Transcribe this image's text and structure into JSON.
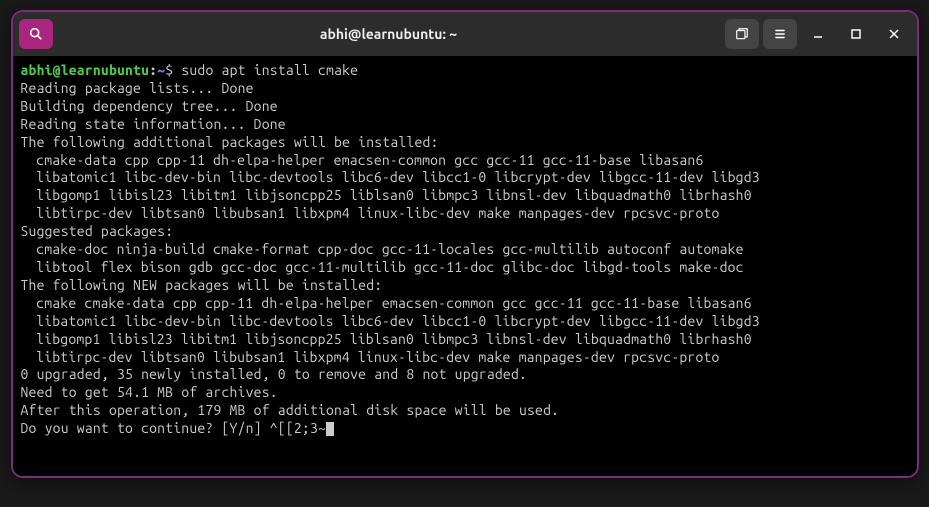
{
  "titlebar": {
    "title": "abhi@learnubuntu: ~"
  },
  "prompt": {
    "user_host": "abhi@learnubuntu",
    "path": "~",
    "symbol": "$",
    "command": "sudo apt install cmake"
  },
  "output": {
    "l1": "Reading package lists... Done",
    "l2": "Building dependency tree... Done",
    "l3": "Reading state information... Done",
    "l4": "The following additional packages will be installed:",
    "l5": "cmake-data cpp cpp-11 dh-elpa-helper emacsen-common gcc gcc-11 gcc-11-base libasan6",
    "l6": "libatomic1 libc-dev-bin libc-devtools libc6-dev libcc1-0 libcrypt-dev libgcc-11-dev libgd3",
    "l7": "libgomp1 libisl23 libitm1 libjsoncpp25 liblsan0 libmpc3 libnsl-dev libquadmath0 librhash0",
    "l8": "libtirpc-dev libtsan0 libubsan1 libxpm4 linux-libc-dev make manpages-dev rpcsvc-proto",
    "l9": "Suggested packages:",
    "l10": "cmake-doc ninja-build cmake-format cpp-doc gcc-11-locales gcc-multilib autoconf automake",
    "l11": "libtool flex bison gdb gcc-doc gcc-11-multilib gcc-11-doc glibc-doc libgd-tools make-doc",
    "l12": "The following NEW packages will be installed:",
    "l13": "cmake cmake-data cpp cpp-11 dh-elpa-helper emacsen-common gcc gcc-11 gcc-11-base libasan6",
    "l14": "libatomic1 libc-dev-bin libc-devtools libc6-dev libcc1-0 libcrypt-dev libgcc-11-dev libgd3",
    "l15": "libgomp1 libisl23 libitm1 libjsoncpp25 liblsan0 libmpc3 libnsl-dev libquadmath0 librhash0",
    "l16": "libtirpc-dev libtsan0 libubsan1 libxpm4 linux-libc-dev make manpages-dev rpcsvc-proto",
    "l17": "0 upgraded, 35 newly installed, 0 to remove and 8 not upgraded.",
    "l18": "Need to get 54.1 MB of archives.",
    "l19": "After this operation, 179 MB of additional disk space will be used.",
    "l20": "Do you want to continue? [Y/n] ^[[2;3~"
  }
}
